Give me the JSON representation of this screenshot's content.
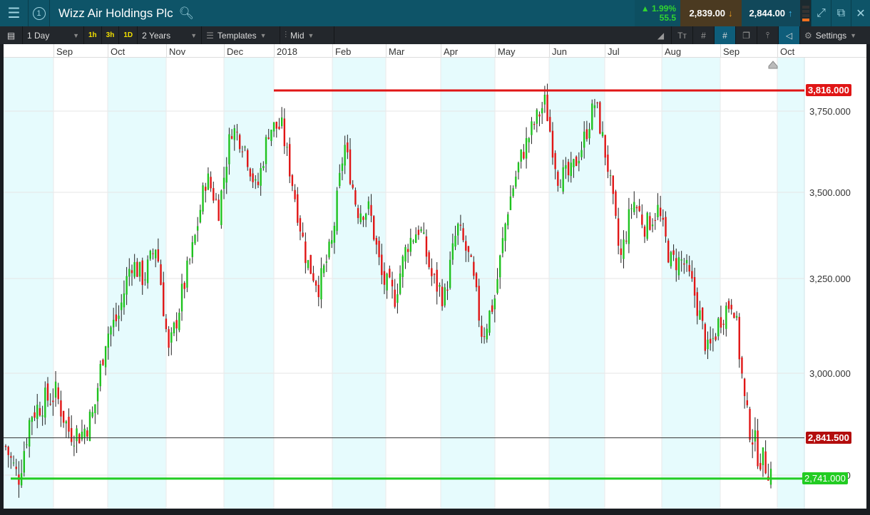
{
  "header": {
    "title": "Wizz Air Holdings Plc",
    "badge": "1",
    "change_pct": "1.99%",
    "change_abs": "55.5",
    "sell": "2,839.00",
    "buy": "2,844.00"
  },
  "toolbar": {
    "interval": "1 Day",
    "quick": [
      "1h",
      "3h",
      "1D"
    ],
    "range": "2 Years",
    "templates": "Templates",
    "price_type": "Mid",
    "settings": "Settings"
  },
  "x_labels": [
    "Sep",
    "Oct",
    "Nov",
    "Dec",
    "2018",
    "Feb",
    "Mar",
    "Apr",
    "May",
    "Jun",
    "Jul",
    "Aug",
    "Sep",
    "Oct"
  ],
  "colors": {
    "up": "#1fc21f",
    "down": "#e01616",
    "resistance": "#e01616",
    "support": "#22cc22",
    "shade": "#e6fbfd"
  },
  "chart_data": {
    "type": "candlestick",
    "title": "Wizz Air Holdings Plc",
    "y_ticks": [
      "3,750.000",
      "3,500.000",
      "3,250.000",
      "3,000.000",
      "2,750.000"
    ],
    "y_tick_values": [
      3750,
      3500,
      3250,
      3000,
      2750
    ],
    "resistance": {
      "value": 3816,
      "label": "3,816.000"
    },
    "support": {
      "value": 2741,
      "label": "2,741.000"
    },
    "current": {
      "value": 2841.5,
      "label": "2,841.500"
    },
    "approx_closes": [
      2820,
      2740,
      2900,
      2930,
      2950,
      2860,
      2850,
      2900,
      3100,
      3150,
      3300,
      3250,
      3350,
      3050,
      3200,
      3350,
      3550,
      3450,
      3700,
      3650,
      3500,
      3700,
      3700,
      3500,
      3300,
      3230,
      3350,
      3650,
      3450,
      3450,
      3250,
      3200,
      3350,
      3400,
      3250,
      3200,
      3400,
      3300,
      3100,
      3200,
      3450,
      3600,
      3700,
      3780,
      3550,
      3550,
      3650,
      3780,
      3580,
      3300,
      3480,
      3400,
      3450,
      3300,
      3300,
      3200,
      3050,
      3150,
      3200,
      2900,
      2800,
      2760
    ]
  }
}
